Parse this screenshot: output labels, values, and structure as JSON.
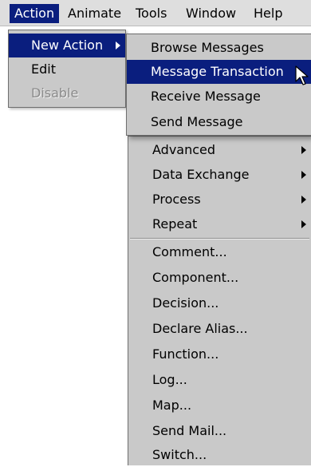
{
  "menubar": {
    "items": [
      {
        "label": "Action",
        "active": true
      },
      {
        "label": "Animate"
      },
      {
        "label": "Tools"
      },
      {
        "label": "Window"
      },
      {
        "label": "Help"
      }
    ]
  },
  "action_menu": {
    "items": [
      {
        "label": "New Action",
        "highlighted": true,
        "submenu": true
      },
      {
        "label": "Edit"
      },
      {
        "label": "Disable",
        "disabled": true
      }
    ]
  },
  "new_action_menu": {
    "items": [
      {
        "label": "Browse Messages"
      },
      {
        "label": "Message Transaction",
        "highlighted": true
      },
      {
        "label": "Receive Message"
      },
      {
        "label": "Send Message"
      }
    ]
  },
  "more_menu": {
    "submenu_items": [
      {
        "label": "Advanced"
      },
      {
        "label": "Data Exchange"
      },
      {
        "label": "Process"
      },
      {
        "label": "Repeat"
      }
    ],
    "items": [
      {
        "label": "Comment..."
      },
      {
        "label": "Component..."
      },
      {
        "label": "Decision..."
      },
      {
        "label": "Declare Alias..."
      },
      {
        "label": "Function..."
      },
      {
        "label": "Log..."
      },
      {
        "label": "Map..."
      },
      {
        "label": "Send Mail..."
      },
      {
        "label": "Switch..."
      }
    ]
  },
  "colors": {
    "highlight": "#0a1e7e",
    "menu_bg": "#c9c9c9",
    "menubar_bg": "#dedede"
  }
}
